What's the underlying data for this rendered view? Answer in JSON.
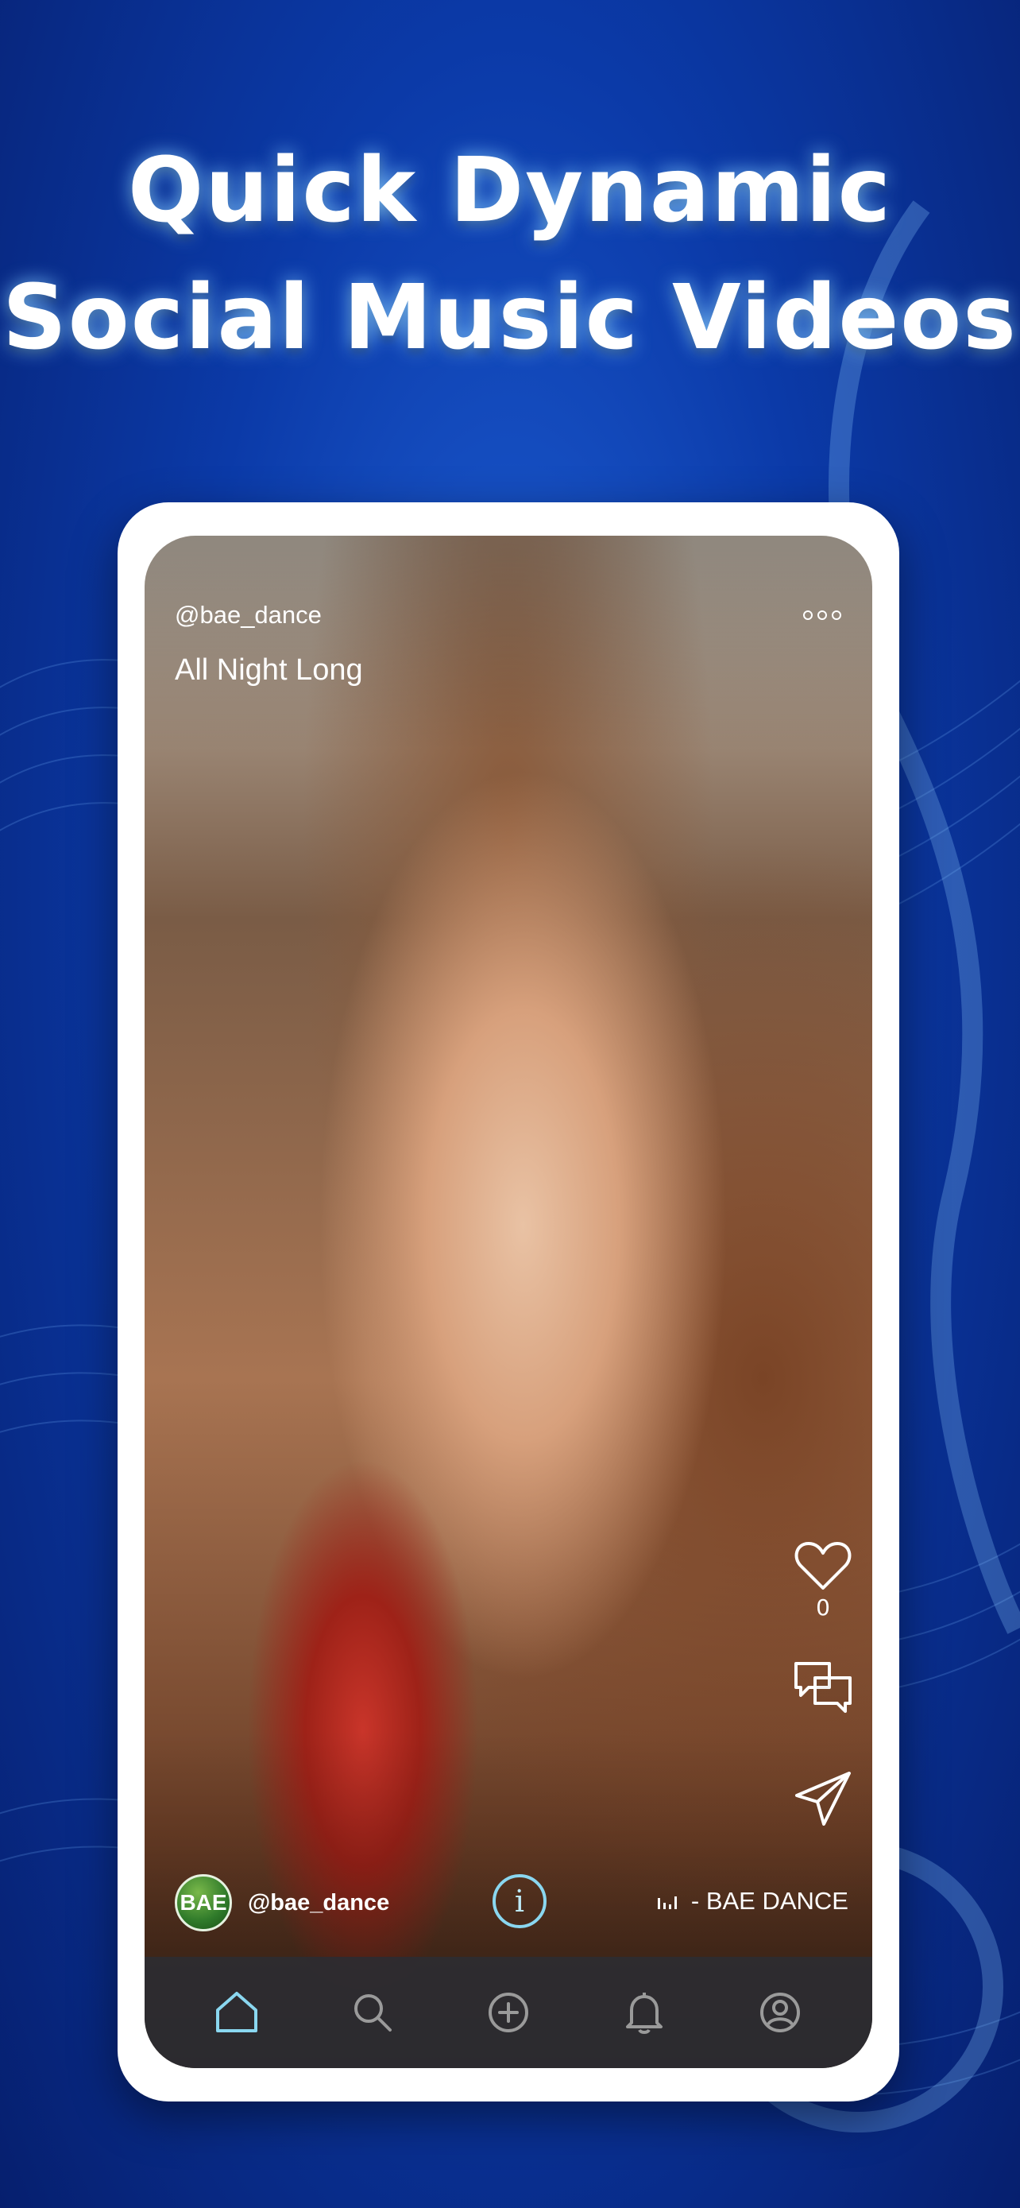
{
  "headline": {
    "line1": "Quick Dynamic",
    "line2": "Social Music Videos"
  },
  "post": {
    "top_username": "@bae_dance",
    "more_icon": "more-horizontal-icon",
    "song_title": "All Night Long",
    "like_count": "0",
    "bottom_username": "@bae_dance",
    "avatar_text": "BAE",
    "track_label": "- BAE DANCE"
  },
  "tabbar": {
    "items": [
      {
        "name": "home",
        "icon": "home-icon",
        "active": true
      },
      {
        "name": "search",
        "icon": "search-icon",
        "active": false
      },
      {
        "name": "create",
        "icon": "plus-circle-icon",
        "active": false
      },
      {
        "name": "notifications",
        "icon": "bell-icon",
        "active": false
      },
      {
        "name": "profile",
        "icon": "profile-icon",
        "active": false
      }
    ],
    "active_color": "#8ad7f0",
    "inactive_color": "#9a9a9a"
  },
  "colors": {
    "background": "#0b3aa8",
    "accent": "#8ad7f0"
  }
}
